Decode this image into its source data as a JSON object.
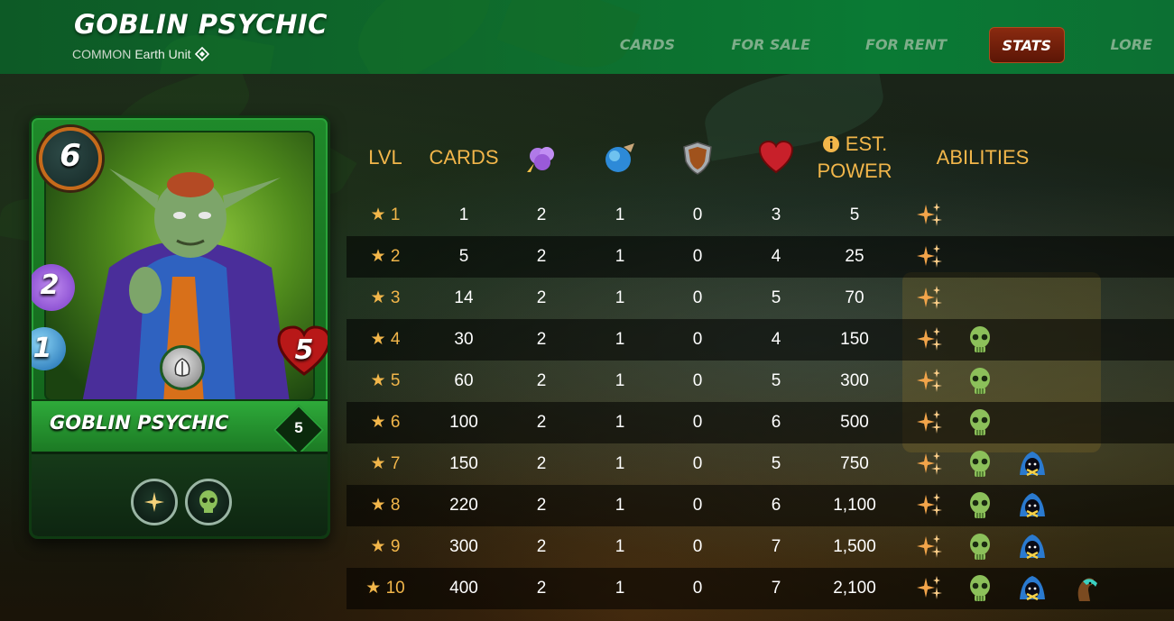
{
  "header": {
    "title": "GOBLIN PSYCHIC",
    "rarity": "COMMON",
    "unit_type": "Earth Unit",
    "nav": [
      "CARDS",
      "FOR SALE",
      "FOR RENT",
      "STATS",
      "LORE"
    ],
    "active_nav": "STATS"
  },
  "card": {
    "name": "GOBLIN PSYCHIC",
    "mana": "6",
    "magic": "2",
    "speed": "1",
    "health": "5",
    "level": "5",
    "abilities": [
      "sparkle-icon",
      "skull-icon"
    ],
    "element": "earth"
  },
  "table": {
    "headers": {
      "lvl": "LVL",
      "cards": "CARDS",
      "est_power_line1": "EST.",
      "est_power_line2": "POWER",
      "abilities": "ABILITIES"
    },
    "stat_icons": [
      "magic-icon",
      "speed-icon",
      "armor-icon",
      "health-icon"
    ],
    "rows": [
      {
        "lvl": "★ 1",
        "cards": "1",
        "magic": "2",
        "speed": "1",
        "armor": "0",
        "health": "3",
        "power": "5",
        "abilities": [
          "sparkle"
        ]
      },
      {
        "lvl": "★ 2",
        "cards": "5",
        "magic": "2",
        "speed": "1",
        "armor": "0",
        "health": "4",
        "power": "25",
        "abilities": [
          "sparkle"
        ]
      },
      {
        "lvl": "★ 3",
        "cards": "14",
        "magic": "2",
        "speed": "1",
        "armor": "0",
        "health": "5",
        "power": "70",
        "abilities": [
          "sparkle"
        ]
      },
      {
        "lvl": "★ 4",
        "cards": "30",
        "magic": "2",
        "speed": "1",
        "armor": "0",
        "health": "4",
        "power": "150",
        "abilities": [
          "sparkle",
          "skull"
        ]
      },
      {
        "lvl": "★ 5",
        "cards": "60",
        "magic": "2",
        "speed": "1",
        "armor": "0",
        "health": "5",
        "power": "300",
        "abilities": [
          "sparkle",
          "skull"
        ]
      },
      {
        "lvl": "★ 6",
        "cards": "100",
        "magic": "2",
        "speed": "1",
        "armor": "0",
        "health": "6",
        "power": "500",
        "abilities": [
          "sparkle",
          "skull"
        ]
      },
      {
        "lvl": "★ 7",
        "cards": "150",
        "magic": "2",
        "speed": "1",
        "armor": "0",
        "health": "5",
        "power": "750",
        "abilities": [
          "sparkle",
          "skull",
          "hood"
        ]
      },
      {
        "lvl": "★ 8",
        "cards": "220",
        "magic": "2",
        "speed": "1",
        "armor": "0",
        "health": "6",
        "power": "1,100",
        "abilities": [
          "sparkle",
          "skull",
          "hood"
        ]
      },
      {
        "lvl": "★ 9",
        "cards": "300",
        "magic": "2",
        "speed": "1",
        "armor": "0",
        "health": "7",
        "power": "1,500",
        "abilities": [
          "sparkle",
          "skull",
          "hood"
        ]
      },
      {
        "lvl": "★ 10",
        "cards": "400",
        "magic": "2",
        "speed": "1",
        "armor": "0",
        "health": "7",
        "power": "2,100",
        "abilities": [
          "sparkle",
          "skull",
          "hood",
          "horse"
        ]
      }
    ]
  },
  "colors": {
    "accent": "#f2b64a",
    "header_green": "#0f6a2c",
    "active_tab": "#6e1e08"
  }
}
